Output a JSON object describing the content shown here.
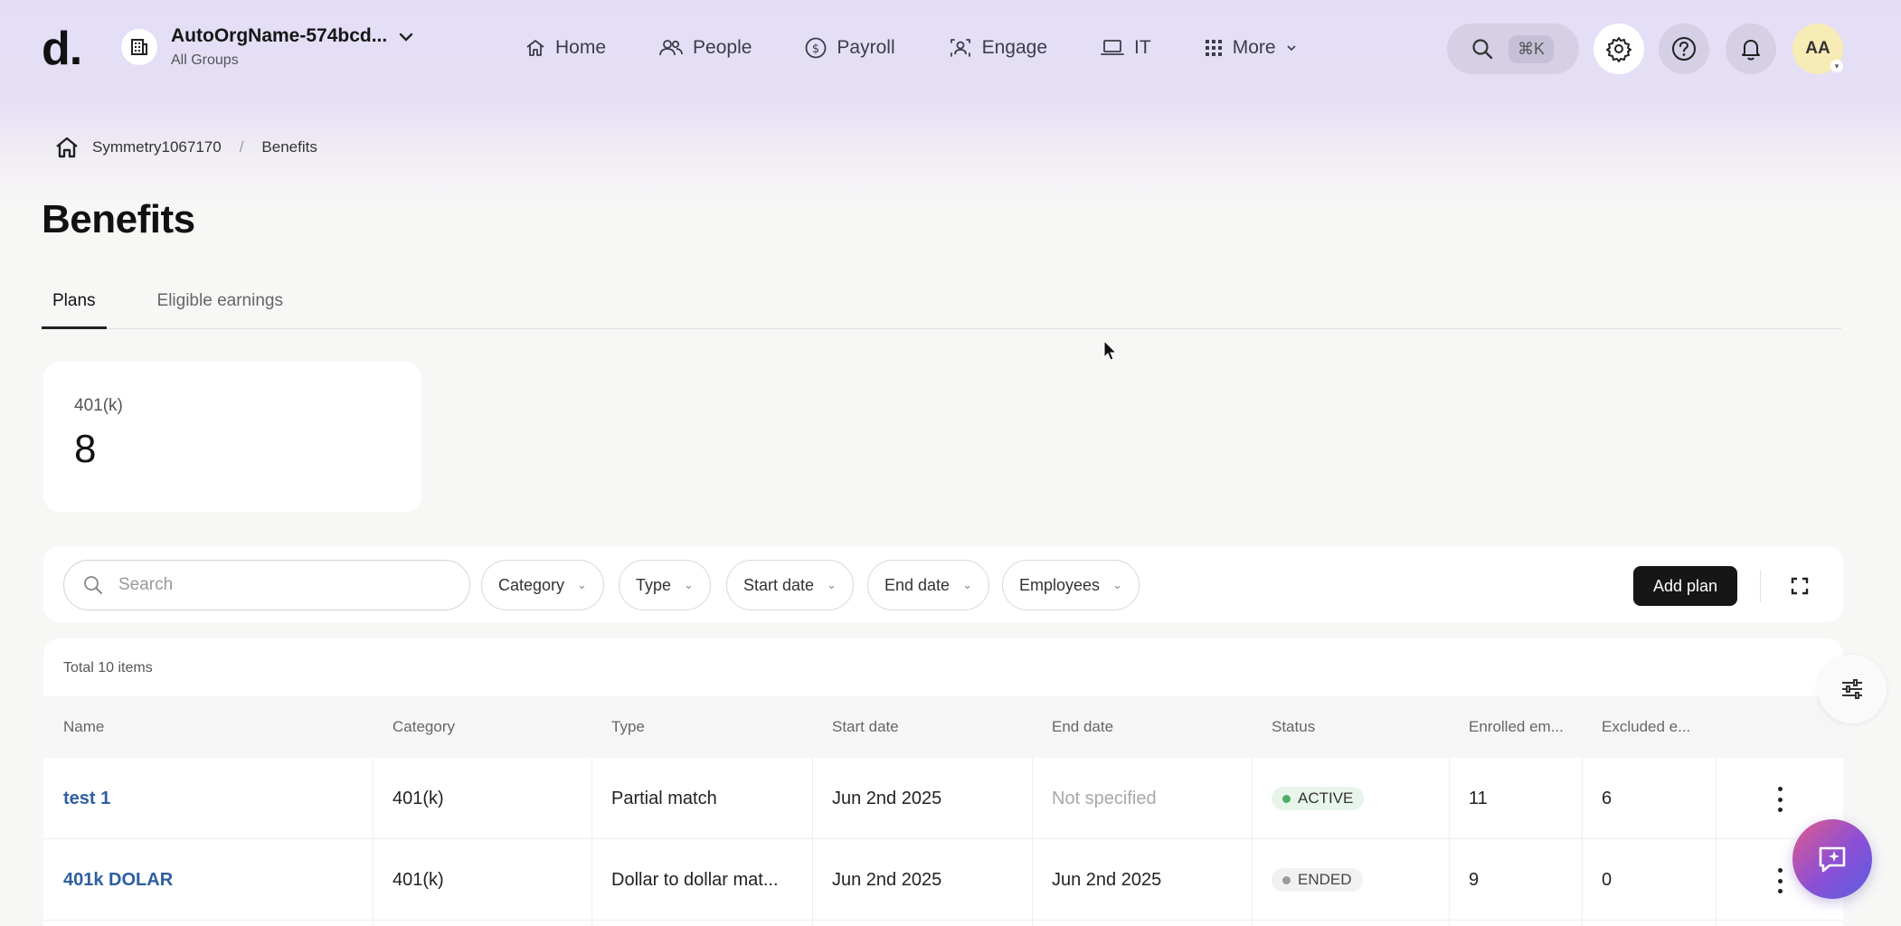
{
  "app": {
    "logo": "d.",
    "org_name": "AutoOrgName-574bcd...",
    "org_sub": "All Groups"
  },
  "nav": {
    "items": [
      {
        "label": "Home",
        "icon": "home-icon"
      },
      {
        "label": "People",
        "icon": "people-icon"
      },
      {
        "label": "Payroll",
        "icon": "payroll-icon"
      },
      {
        "label": "Engage",
        "icon": "engage-icon"
      },
      {
        "label": "IT",
        "icon": "laptop-icon"
      },
      {
        "label": "More",
        "icon": "grid-icon"
      }
    ],
    "search_shortcut": "⌘K",
    "avatar_initials": "AA"
  },
  "breadcrumb": {
    "root": "Symmetry1067170",
    "current": "Benefits"
  },
  "page": {
    "title": "Benefits",
    "tabs": [
      "Plans",
      "Eligible earnings"
    ]
  },
  "stat_card": {
    "label": "401(k)",
    "value": "8"
  },
  "filters": {
    "search_placeholder": "Search",
    "category": "Category",
    "type": "Type",
    "start_date": "Start date",
    "end_date": "End date",
    "employees": "Employees",
    "add_plan": "Add plan"
  },
  "table": {
    "total": "Total 10 items",
    "headers": [
      "Name",
      "Category",
      "Type",
      "Start date",
      "End date",
      "Status",
      "Enrolled em...",
      "Excluded e..."
    ],
    "rows": [
      {
        "name": "test 1",
        "category": "401(k)",
        "type": "Partial match",
        "start": "Jun 2nd 2025",
        "end": "Not specified",
        "status": "ACTIVE",
        "enrolled": "11",
        "excluded": "6"
      },
      {
        "name": "401k DOLAR",
        "category": "401(k)",
        "type": "Dollar to dollar mat...",
        "start": "Jun 2nd 2025",
        "end": "Jun 2nd 2025",
        "status": "ENDED",
        "enrolled": "9",
        "excluded": "0"
      }
    ]
  },
  "colors": {
    "header_bg": "#e3ddf7",
    "link": "#2d5fa0",
    "active_dot": "#4caf68",
    "primary_button": "#161616"
  }
}
